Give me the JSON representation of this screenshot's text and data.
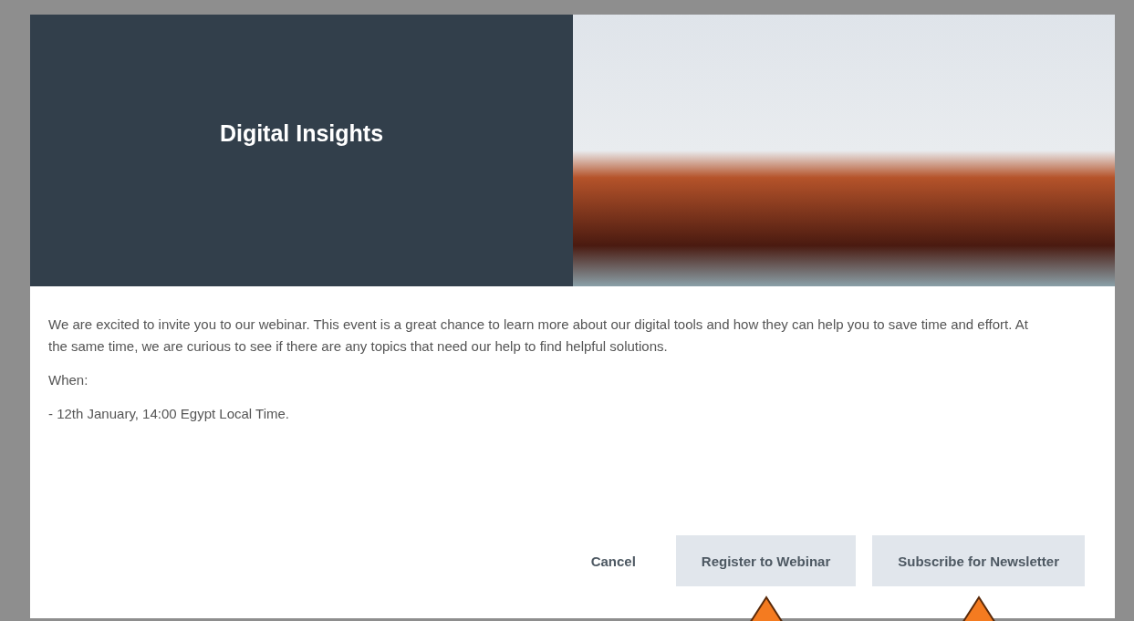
{
  "dialog": {
    "title": "Digital Insights",
    "paragraphs": [
      "We are excited to invite you to our webinar. This event is a great chance to learn more about our digital tools and how they can help you to save time and effort. At the same time, we are curious to see if there are any topics that need our help to find helpful solutions.",
      "When:",
      "- 12th January, 14:00 Egypt Local Time."
    ],
    "buttons": [
      {
        "label": "Cancel",
        "kind": "plain",
        "marked": false
      },
      {
        "label": "Register to Webinar",
        "kind": "filled",
        "marked": true
      },
      {
        "label": "Subscribe for Newsletter",
        "kind": "filled",
        "marked": true
      }
    ]
  }
}
